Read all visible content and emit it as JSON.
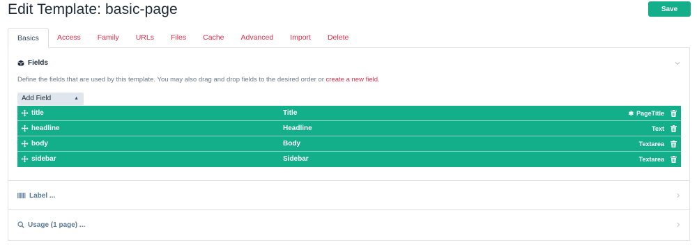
{
  "page": {
    "title": "Edit Template: basic-page"
  },
  "header": {
    "save_label": "Save"
  },
  "tabs": [
    {
      "label": "Basics",
      "active": true
    },
    {
      "label": "Access"
    },
    {
      "label": "Family"
    },
    {
      "label": "URLs"
    },
    {
      "label": "Files"
    },
    {
      "label": "Cache"
    },
    {
      "label": "Advanced"
    },
    {
      "label": "Import"
    },
    {
      "label": "Delete"
    }
  ],
  "fields_section": {
    "title": "Fields",
    "description": "Define the fields that are used by this template. You may also drag and drop fields to the desired order or",
    "create_link": "create a new field.",
    "add_field": {
      "selected": "Add Field"
    },
    "rows": [
      {
        "name": "title",
        "label": "Title",
        "type": "PageTitle",
        "required": true
      },
      {
        "name": "headline",
        "label": "Headline",
        "type": "Text"
      },
      {
        "name": "body",
        "label": "Body",
        "type": "Textarea"
      },
      {
        "name": "sidebar",
        "label": "Sidebar",
        "type": "Textarea"
      }
    ]
  },
  "label_section": {
    "title": "Label ..."
  },
  "usage_section": {
    "title": "Usage (1 page) ..."
  },
  "colors": {
    "accent": "#13ae8a",
    "link": "#e22f4c",
    "heading": "#1c2836"
  }
}
